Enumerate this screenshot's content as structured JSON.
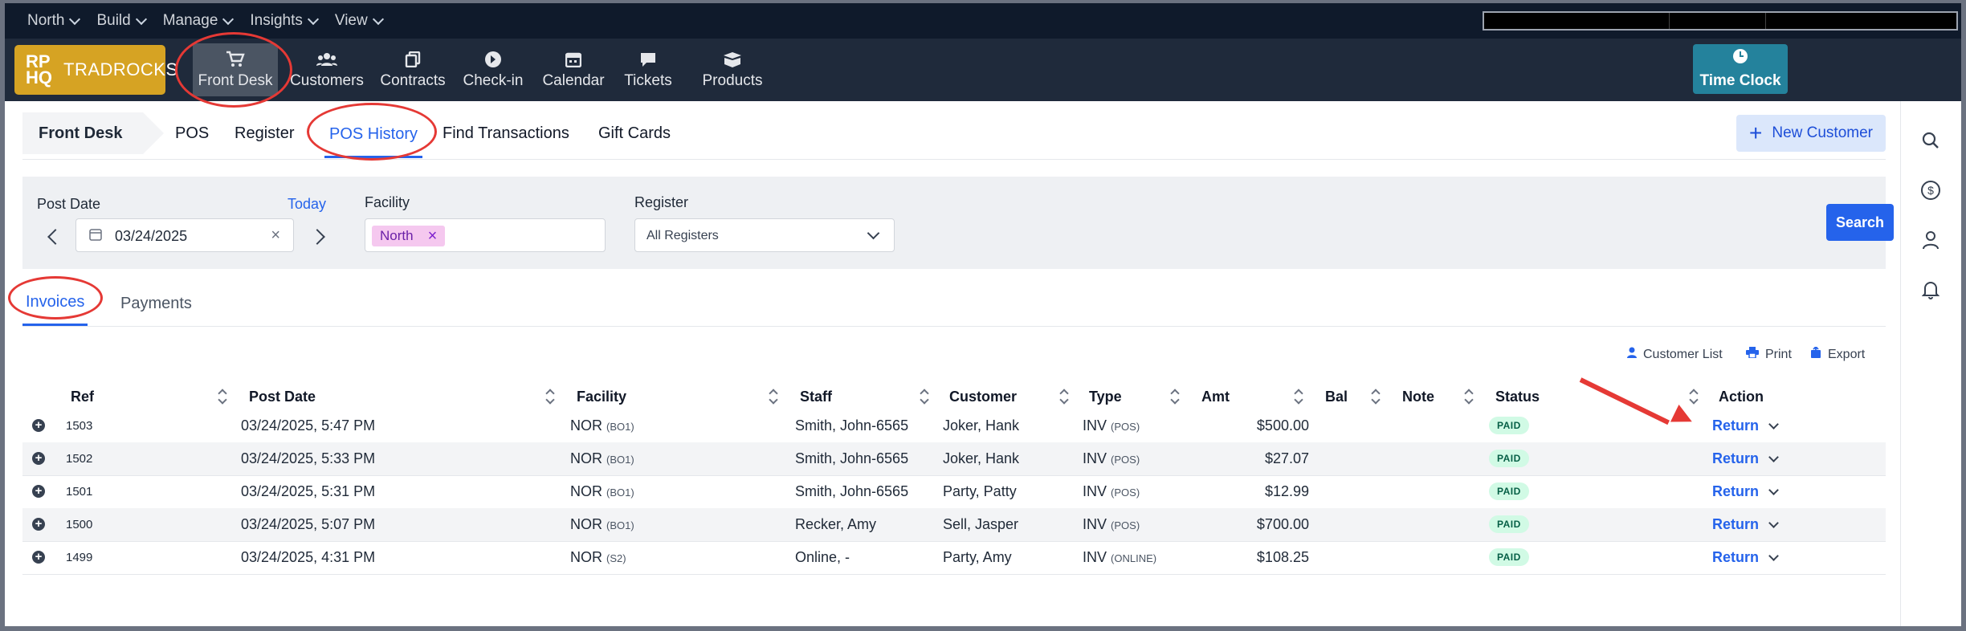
{
  "top_menu": [
    {
      "label": "North"
    },
    {
      "label": "Build"
    },
    {
      "label": "Manage"
    },
    {
      "label": "Insights"
    },
    {
      "label": "View"
    }
  ],
  "brand": {
    "mark_line1": "RP",
    "mark_line2": "HQ",
    "name": "TRADROCKS",
    "color": "#d6a323"
  },
  "main_nav": [
    {
      "label": "Front Desk",
      "icon": "cart-icon",
      "active": true
    },
    {
      "label": "Customers",
      "icon": "users-icon"
    },
    {
      "label": "Contracts",
      "icon": "contracts-icon"
    },
    {
      "label": "Check-in",
      "icon": "arrow-circle-icon"
    },
    {
      "label": "Calendar",
      "icon": "calendar-icon"
    },
    {
      "label": "Tickets",
      "icon": "chat-icon"
    },
    {
      "label": "Products",
      "icon": "products-icon"
    }
  ],
  "time_clock": {
    "label": "Time Clock",
    "icon": "clock-icon"
  },
  "sub_tabs": {
    "breadcrumb": "Front Desk",
    "items": [
      {
        "label": "POS"
      },
      {
        "label": "Register"
      },
      {
        "label": "POS History",
        "active": true
      },
      {
        "label": "Find Transactions"
      },
      {
        "label": "Gift Cards"
      }
    ],
    "new_customer": "New Customer"
  },
  "filters": {
    "post_date_label": "Post Date",
    "today_link": "Today",
    "date_value": "03/24/2025",
    "facility_label": "Facility",
    "facility_tag": "North",
    "register_label": "Register",
    "register_value": "All Registers",
    "search_button": "Search"
  },
  "inner_tabs": [
    {
      "label": "Invoices",
      "active": true
    },
    {
      "label": "Payments"
    }
  ],
  "tools": {
    "customer_list": "Customer List",
    "print": "Print",
    "export": "Export"
  },
  "table": {
    "headers": {
      "ref": "Ref",
      "post_date": "Post Date",
      "facility": "Facility",
      "staff": "Staff",
      "customer": "Customer",
      "type": "Type",
      "amt": "Amt",
      "bal": "Bal",
      "note": "Note",
      "status": "Status",
      "action": "Action"
    },
    "rows": [
      {
        "ref": "1503",
        "post_date": "03/24/2025, 5:47 PM",
        "facility": "NOR",
        "facility_sub": "(BO1)",
        "staff": "Smith, John-6565",
        "customer": "Joker, Hank",
        "type": "INV",
        "type_sub": "(POS)",
        "amt": "$500.00",
        "status": "PAID",
        "action": "Return"
      },
      {
        "ref": "1502",
        "post_date": "03/24/2025, 5:33 PM",
        "facility": "NOR",
        "facility_sub": "(BO1)",
        "staff": "Smith, John-6565",
        "customer": "Joker, Hank",
        "type": "INV",
        "type_sub": "(POS)",
        "amt": "$27.07",
        "status": "PAID",
        "action": "Return"
      },
      {
        "ref": "1501",
        "post_date": "03/24/2025, 5:31 PM",
        "facility": "NOR",
        "facility_sub": "(BO1)",
        "staff": "Smith, John-6565",
        "customer": "Party, Patty",
        "type": "INV",
        "type_sub": "(POS)",
        "amt": "$12.99",
        "status": "PAID",
        "action": "Return"
      },
      {
        "ref": "1500",
        "post_date": "03/24/2025, 5:07 PM",
        "facility": "NOR",
        "facility_sub": "(BO1)",
        "staff": "Recker, Amy",
        "customer": "Sell, Jasper",
        "type": "INV",
        "type_sub": "(POS)",
        "amt": "$700.00",
        "status": "PAID",
        "action": "Return"
      },
      {
        "ref": "1499",
        "post_date": "03/24/2025, 4:31 PM",
        "facility": "NOR",
        "facility_sub": "(S2)",
        "staff": "Online, -",
        "customer": "Party, Amy",
        "type": "INV",
        "type_sub": "(ONLINE)",
        "amt": "$108.25",
        "status": "PAID",
        "action": "Return"
      }
    ]
  },
  "colors": {
    "accent": "#2563eb",
    "topbar": "#0f1a2b",
    "navbar": "#1f2a3b",
    "time_clock": "#24829c",
    "annotation": "#e53935",
    "paid_badge": "#d1fae5"
  }
}
